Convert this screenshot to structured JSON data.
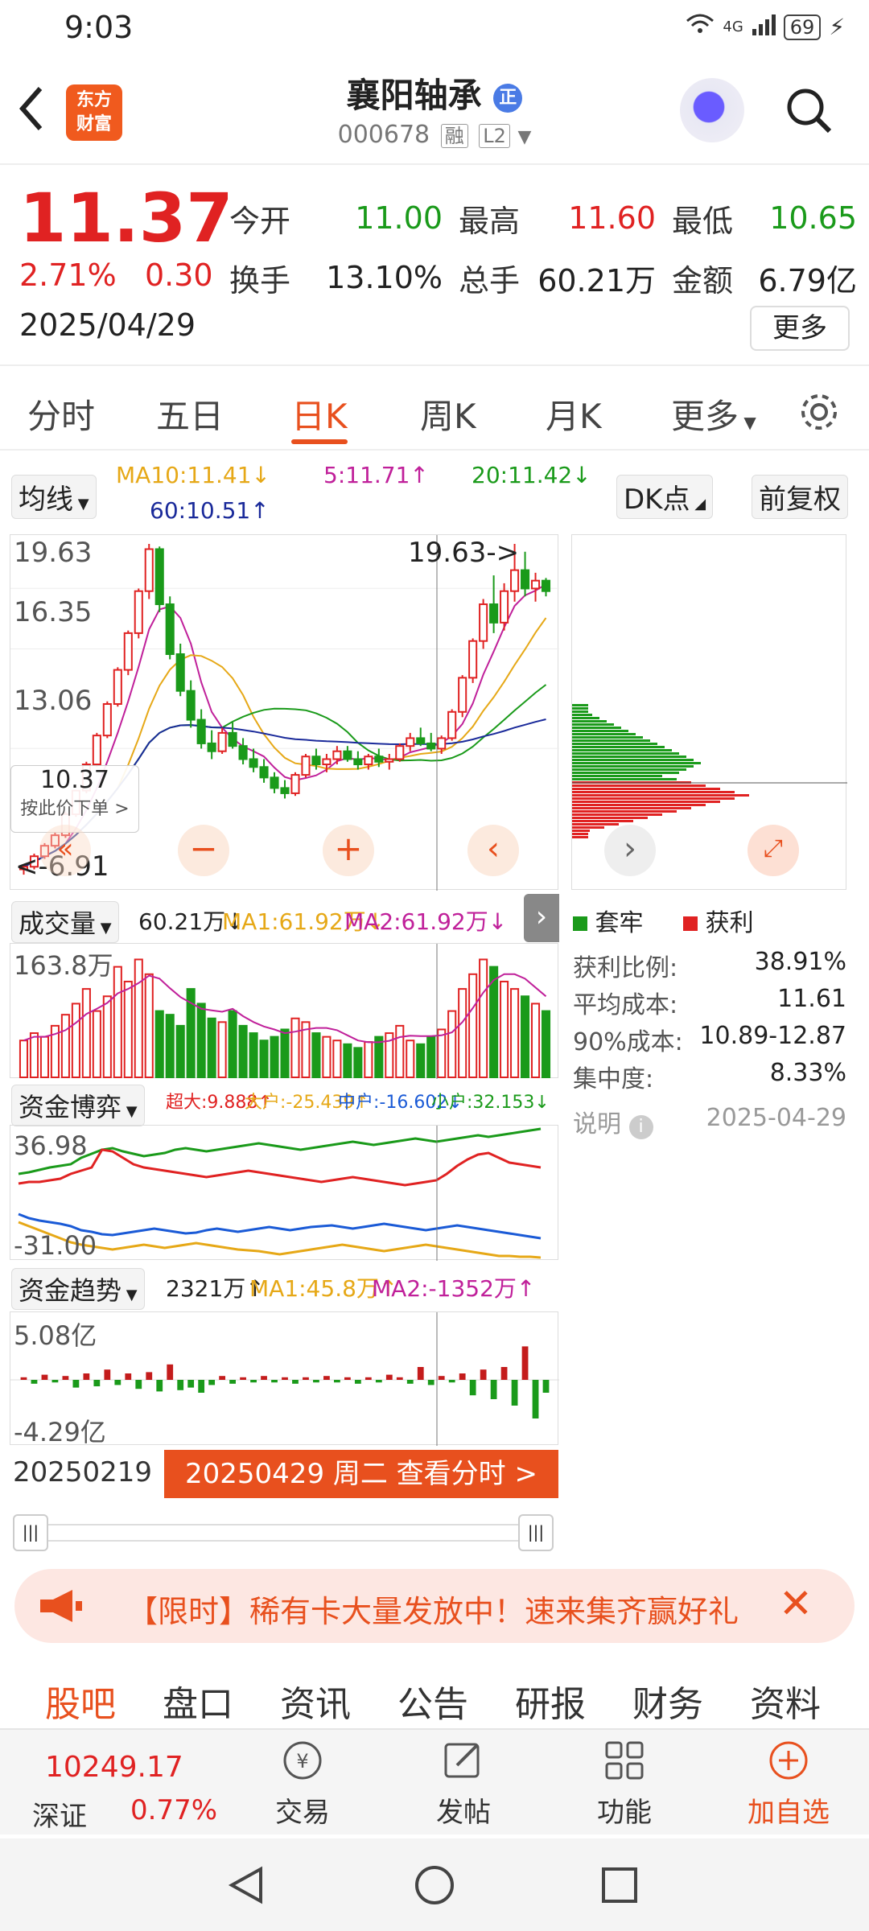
{
  "status": {
    "time": "9:03",
    "net": "4G",
    "battery": "69"
  },
  "header": {
    "logo_text": "东方\n财富",
    "title": "襄阳轴承",
    "code": "000678",
    "tag1": "融",
    "tag2": "L2"
  },
  "quote": {
    "price": "11.37",
    "pct": "2.71%",
    "change": "0.30",
    "date": "2025/04/29",
    "open_l": "今开",
    "open": "11.00",
    "high_l": "最高",
    "high": "11.60",
    "low_l": "最低",
    "low": "10.65",
    "turn_l": "换手",
    "turn": "13.10%",
    "vol_l": "总手",
    "vol": "60.21万",
    "amt_l": "金额",
    "amt": "6.79亿",
    "more": "更多"
  },
  "tabs": [
    "分时",
    "五日",
    "日K",
    "周K",
    "月K",
    "更多"
  ],
  "active_tab": "日K",
  "kline": {
    "ma_btn": "均线",
    "ma10": "MA10:11.41↓",
    "ma5": "5:11.71↑",
    "ma20": "20:11.42↓",
    "ma60": "60:10.51↑",
    "dk": "DK点",
    "fq": "前复权",
    "y_high": "19.63",
    "y_mid1": "16.35",
    "y_mid2": "13.06",
    "y_low": "6.91",
    "peak_label": "19.63->",
    "cursor_price": "10.37",
    "cursor_tip": "按此价下单 >",
    "low_label": "<-6.91"
  },
  "volume": {
    "btn": "成交量",
    "val": "60.21万↓",
    "ma1": "MA1:61.92万↓",
    "ma2": "MA2:61.92万↓",
    "y_high": "163.8万"
  },
  "funds": {
    "btn": "资金博弈",
    "cd": "超大:9.888↑",
    "dh": "大户:-25.439↑",
    "zh": "中户:-16.602↓",
    "xh": "小户:32.153↓",
    "y_high": "36.98",
    "y_low": "-31.00"
  },
  "trend": {
    "btn": "资金趋势",
    "val": "2321万↑",
    "ma1": "MA1:45.8万↑",
    "ma2": "MA2:-1352万↑",
    "y_high": "5.08亿",
    "y_low": "-4.29亿"
  },
  "timeline": {
    "start": "20250219",
    "current": "20250429 周二 查看分时 >"
  },
  "chips": {
    "legend_tl": "套牢",
    "legend_hl": "获利",
    "rows": [
      [
        "获利比例:",
        "38.91%"
      ],
      [
        "平均成本:",
        "11.61"
      ],
      [
        "90%成本:",
        "10.89-12.87"
      ],
      [
        "集中度:",
        "8.33%"
      ]
    ],
    "note": "说明",
    "date": "2025-04-29"
  },
  "promo": {
    "text": "【限时】稀有卡大量发放中！速来集齐赢好礼"
  },
  "bottom_tabs": [
    "股吧",
    "盘口",
    "资讯",
    "公告",
    "研报",
    "财务",
    "资料"
  ],
  "footer": {
    "index_val": "10249.17",
    "index_name": "深证",
    "index_pct": "0.77%",
    "trade": "交易",
    "post": "发帖",
    "func": "功能",
    "add": "加自选"
  },
  "colors": {
    "up": "#e02222",
    "down": "#1a9a1a",
    "accent": "#e8501e"
  },
  "chart_data": {
    "type": "candlestick",
    "ylim": [
      6.91,
      19.63
    ],
    "candles": [
      [
        7.2,
        7.4,
        7.0,
        7.3
      ],
      [
        7.3,
        7.8,
        7.2,
        7.7
      ],
      [
        7.7,
        8.2,
        7.6,
        8.1
      ],
      [
        8.1,
        8.6,
        8.0,
        8.5
      ],
      [
        8.5,
        9.4,
        8.4,
        9.3
      ],
      [
        9.3,
        10.2,
        9.2,
        10.2
      ],
      [
        10.2,
        11.3,
        10.1,
        11.2
      ],
      [
        11.2,
        12.4,
        11.1,
        12.3
      ],
      [
        12.3,
        13.6,
        12.2,
        13.5
      ],
      [
        13.5,
        14.9,
        13.4,
        14.8
      ],
      [
        14.8,
        16.3,
        14.6,
        16.2
      ],
      [
        16.2,
        17.9,
        16.0,
        17.8
      ],
      [
        17.8,
        19.6,
        17.5,
        19.4
      ],
      [
        19.4,
        19.5,
        17.0,
        17.3
      ],
      [
        17.3,
        17.6,
        15.2,
        15.4
      ],
      [
        15.4,
        15.8,
        13.8,
        14.0
      ],
      [
        14.0,
        14.4,
        12.6,
        12.9
      ],
      [
        12.9,
        13.3,
        11.8,
        12.0
      ],
      [
        12.0,
        12.5,
        11.4,
        11.7
      ],
      [
        11.7,
        12.6,
        11.6,
        12.4
      ],
      [
        12.4,
        12.8,
        11.8,
        11.9
      ],
      [
        11.9,
        12.2,
        11.2,
        11.4
      ],
      [
        11.4,
        11.8,
        10.9,
        11.1
      ],
      [
        11.1,
        11.4,
        10.5,
        10.7
      ],
      [
        10.7,
        10.9,
        10.1,
        10.3
      ],
      [
        10.3,
        10.6,
        9.9,
        10.1
      ],
      [
        10.1,
        10.9,
        10.0,
        10.8
      ],
      [
        10.8,
        11.6,
        10.7,
        11.5
      ],
      [
        11.5,
        11.8,
        11.0,
        11.2
      ],
      [
        11.2,
        11.6,
        10.9,
        11.4
      ],
      [
        11.4,
        11.9,
        11.2,
        11.7
      ],
      [
        11.7,
        11.9,
        11.3,
        11.4
      ],
      [
        11.4,
        11.7,
        11.0,
        11.2
      ],
      [
        11.2,
        11.6,
        11.0,
        11.5
      ],
      [
        11.5,
        11.8,
        11.1,
        11.3
      ],
      [
        11.3,
        11.6,
        11.0,
        11.4
      ],
      [
        11.4,
        12.0,
        11.3,
        11.9
      ],
      [
        11.9,
        12.4,
        11.7,
        12.2
      ],
      [
        12.2,
        12.6,
        11.9,
        12.0
      ],
      [
        12.0,
        12.4,
        11.7,
        11.8
      ],
      [
        11.8,
        12.3,
        11.6,
        12.2
      ],
      [
        12.2,
        13.3,
        12.1,
        13.2
      ],
      [
        13.2,
        14.6,
        13.0,
        14.5
      ],
      [
        14.5,
        16.0,
        14.3,
        15.9
      ],
      [
        15.9,
        17.5,
        15.6,
        17.3
      ],
      [
        17.3,
        18.4,
        16.2,
        16.6
      ],
      [
        16.6,
        18.1,
        16.3,
        17.8
      ],
      [
        17.8,
        19.6,
        17.4,
        18.6
      ],
      [
        18.6,
        19.3,
        17.6,
        17.9
      ],
      [
        17.9,
        18.5,
        17.4,
        18.2
      ],
      [
        18.2,
        18.3,
        17.6,
        17.8
      ]
    ]
  }
}
